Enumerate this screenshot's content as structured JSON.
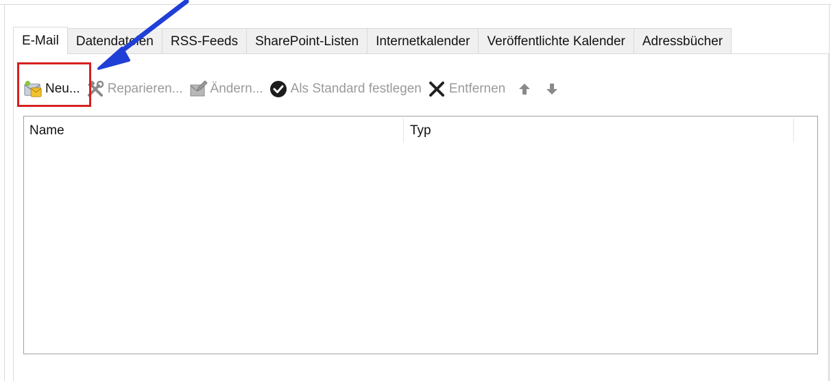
{
  "tabs": [
    {
      "label": "E-Mail",
      "active": true
    },
    {
      "label": "Datendateien",
      "active": false
    },
    {
      "label": "RSS-Feeds",
      "active": false
    },
    {
      "label": "SharePoint-Listen",
      "active": false
    },
    {
      "label": "Internetkalender",
      "active": false
    },
    {
      "label": "Veröffentlichte Kalender",
      "active": false
    },
    {
      "label": "Adressbücher",
      "active": false
    }
  ],
  "toolbar": {
    "new_label": "Neu...",
    "repair_label": "Reparieren...",
    "change_label": "Ändern...",
    "default_label": "Als Standard festlegen",
    "remove_label": "Entfernen"
  },
  "list": {
    "columns": [
      "Name",
      "Typ"
    ],
    "rows": []
  },
  "colors": {
    "highlight": "#d61f1f",
    "annotation_arrow": "#1f3fd6",
    "disabled_text": "#9a9a9a"
  },
  "icons": {
    "new": "envelope-new-icon",
    "repair": "tools-icon",
    "change": "change-icon",
    "default": "checkmark-circle-icon",
    "remove": "x-icon",
    "up": "arrow-up-icon",
    "down": "arrow-down-icon"
  }
}
